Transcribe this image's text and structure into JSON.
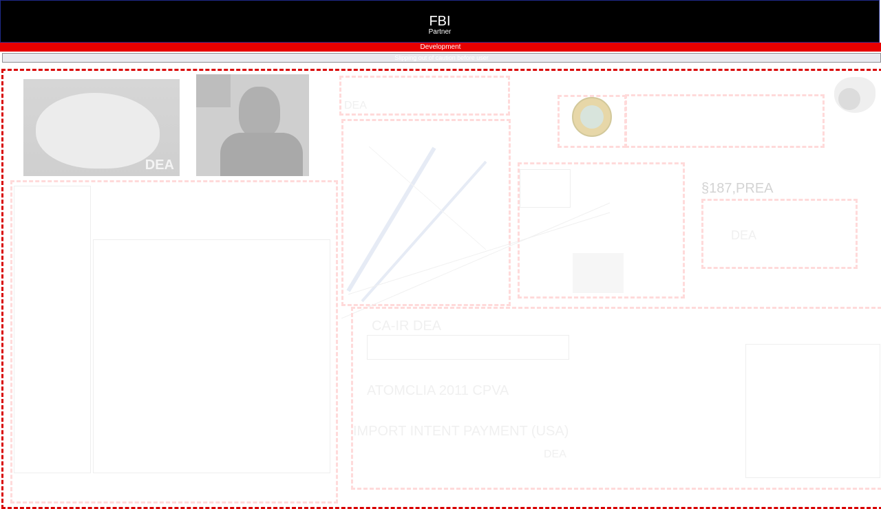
{
  "header": {
    "title": "FBI",
    "subtitle": "Partner"
  },
  "environment_banner": "Development",
  "notice_bar": "Slipping out of caution before user",
  "canvas": {
    "heading_prea": "§187,PREA",
    "label_ca": "CA-IR  DEA",
    "label_atom": "ATOMCLIA  2011 CPVA",
    "label_import": "IMPORT INTENT PAYMENT (USA)",
    "label_dea_box": "DEA",
    "label_dea_top": "DEA",
    "label_dea_bottom": "DEA",
    "photo_watermark": "DEA"
  },
  "colors": {
    "header_bg": "#000000",
    "banner_red": "#e60000",
    "canvas_border": "#d80000",
    "ghost_border": "#ffdada",
    "notice_bg": "#e9e9ee"
  }
}
